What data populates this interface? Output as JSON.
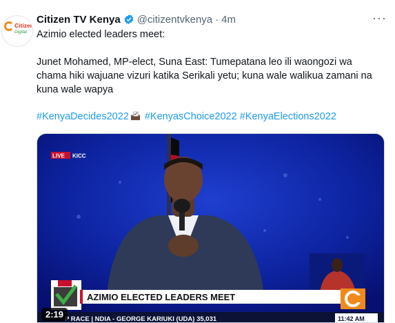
{
  "tweet": {
    "author_name": "Citizen TV Kenya",
    "handle": "@citizentvkenya",
    "separator": "·",
    "time": "4m",
    "more": "···",
    "avatar_text_1": "Citizen",
    "avatar_text_2": "Digital",
    "line1": "Azimio elected leaders meet:",
    "line2": "Junet Mohamed, MP-elect, Suna East: Tumepatana leo ili waongozi wa",
    "line3": "chama hiki wajuane vizuri katika Serikali yetu; kuna wale walikua zamani na",
    "line4": "kuna wale wapya",
    "hashtags": [
      "#KenyaDecides2022",
      "#KenyasChoice2022",
      "#KenyaElections2022"
    ]
  },
  "video": {
    "live_label": "LIVE",
    "location": "KICC",
    "headline": "AZIMIO ELECTED LEADERS MEET",
    "ticker": "P RACE | NDIA - GEORGE KARIUKI (UDA) 35,031",
    "clock": "11:42 AM",
    "duration": "2:19"
  },
  "colors": {
    "link": "#1d9bf0",
    "verified": "#1d9bf0",
    "video_bg": "#0d1f86",
    "headline_bar": "#ffffff",
    "accent_red": "#c8102e"
  }
}
